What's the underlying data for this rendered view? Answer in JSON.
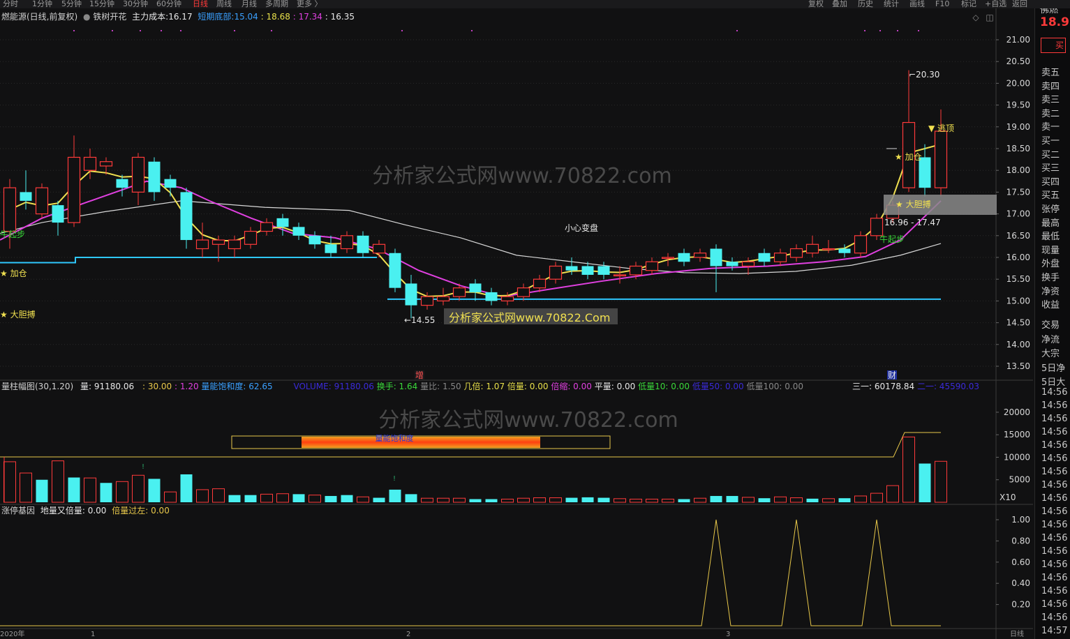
{
  "period_tabs": [
    "分时",
    "1分钟",
    "5分钟",
    "15分钟",
    "30分钟",
    "60分钟",
    "日线",
    "周线",
    "月线",
    "多周期",
    "更多 〉"
  ],
  "active_tab": "日线",
  "right_buttons": [
    "复权",
    "叠加",
    "历史",
    "统计",
    "画线",
    "F10",
    "标记",
    "+自选",
    "返回"
  ],
  "stock_title": "燃能源(日线,前复权)",
  "indicator_name": "铁树开花",
  "cost_label": "主力成本:",
  "cost_value": "16.17",
  "short_bottom_label": "短期底部:",
  "short_bottom_value": "15.04",
  "v2": "18.68",
  "v3": "17.34",
  "v4": "16.35",
  "watermark_top": "分析家公式网www.70822.com",
  "watermark_box": "分析家公式网www.70822.Com",
  "watermark_mid": "分析家公式网www.70822.com",
  "signals": {
    "buy_start": "牛起步",
    "add_pos": "★ 加仓",
    "bold": "★ 大胆搏",
    "add_right": "★ 加仓",
    "escape_top": "▼ 逃顶",
    "bold_right": "★ 大胆搏",
    "buy_start_right": "牛起步",
    "careful": "小心变盘"
  },
  "price_annotations": {
    "high": "20.30",
    "low": "←14.55",
    "band": "16.96 - 17.47"
  },
  "markers": {
    "zeng": "增",
    "cai": "财"
  },
  "price_axis": [
    "21.00",
    "20.50",
    "20.00",
    "19.50",
    "19.00",
    "18.50",
    "18.00",
    "17.50",
    "17.00",
    "16.50",
    "16.00",
    "15.50",
    "15.00",
    "14.50",
    "14.00",
    "13.50"
  ],
  "vol_header": {
    "name": "量柱幅图(30,1.20)",
    "vol_label": "量:",
    "vol_value": "91180.06",
    "p1": ": 30.00",
    "p2": ": 1.20",
    "sat_label": "量能饱和度:",
    "sat_value": "62.65",
    "volume_label": "VOLUME: 91180.06",
    "turnover": "换手: 1.64",
    "ratio": "量比: 1.50",
    "times": "几倍: 1.07",
    "double": "倍量: 0.00",
    "shrink": "倍缩: 0.00",
    "flat": "平量: 0.00",
    "low10": "低量10: 0.00",
    "low50": "低量50: 0.00",
    "low100": "低量100: 0.00",
    "sanyi": "三一: 60178.84",
    "sanyi2": "二一: 45590.03"
  },
  "saturation_bar_label": "量能饱和度",
  "vol_axis": [
    "20000",
    "15000",
    "10000",
    "5000"
  ],
  "vol_unit": "X10",
  "zt_header": {
    "name": "涨停基因",
    "label1": "地量又倍量: 0.00",
    "label2": "倍量过左: 0.00"
  },
  "zt_axis": [
    "1.00",
    "0.80",
    "0.60",
    "0.40",
    "0.20"
  ],
  "side_price": "18.9",
  "side_buy_btn": "买",
  "side_header": "佛燃",
  "side_labels": [
    "卖五",
    "卖四",
    "卖三",
    "卖二",
    "卖一",
    "买一",
    "买二",
    "买三",
    "买四",
    "买五",
    "张停",
    "最高",
    "最低",
    "现量",
    "外盘",
    "换手",
    "净资",
    "收益",
    "交易",
    "净流",
    "大宗",
    "5日净",
    "5日大"
  ],
  "side_times": [
    "14:56",
    "14:56",
    "14:56",
    "14:56",
    "14:56",
    "14:56",
    "14:56",
    "14:56",
    "14:56",
    "14:56",
    "14:56",
    "14:56",
    "14:56",
    "14:56",
    "14:56",
    "14:56",
    "14:56",
    "14:56",
    "14:57"
  ],
  "bottom_axis": [
    "2020年",
    "1",
    "2",
    "3",
    "日线"
  ],
  "chart_data": [
    {
      "type": "candlestick",
      "y_range": [
        13.3,
        21.3
      ],
      "candles": [
        [
          16.6,
          17.6,
          17.8,
          16.2
        ],
        [
          17.5,
          17.3,
          18.0,
          17.1
        ],
        [
          17.0,
          17.6,
          17.7,
          16.9
        ],
        [
          17.2,
          16.8,
          17.3,
          16.5
        ],
        [
          16.8,
          18.3,
          18.8,
          16.7
        ],
        [
          18.0,
          18.3,
          18.5,
          17.8
        ],
        [
          18.1,
          18.2,
          18.3,
          17.9
        ],
        [
          17.8,
          17.6,
          17.9,
          17.4
        ],
        [
          17.5,
          18.3,
          18.4,
          17.2
        ],
        [
          18.2,
          17.5,
          18.3,
          17.3
        ],
        [
          17.8,
          17.6,
          17.9,
          17.4
        ],
        [
          17.5,
          16.4,
          17.6,
          16.2
        ],
        [
          16.2,
          16.4,
          16.8,
          16.0
        ],
        [
          16.3,
          16.4,
          16.5,
          15.9
        ],
        [
          16.2,
          16.4,
          16.5,
          16.0
        ],
        [
          16.3,
          16.6,
          16.7,
          16.2
        ],
        [
          16.6,
          16.8,
          16.9,
          16.5
        ],
        [
          16.9,
          16.7,
          17.0,
          16.5
        ],
        [
          16.7,
          16.5,
          16.8,
          16.4
        ],
        [
          16.5,
          16.3,
          16.6,
          16.2
        ],
        [
          16.3,
          16.1,
          16.5,
          16.0
        ],
        [
          16.2,
          16.5,
          16.6,
          16.1
        ],
        [
          16.5,
          16.1,
          16.6,
          16.0
        ],
        [
          16.1,
          16.3,
          16.4,
          16.0
        ],
        [
          16.1,
          15.3,
          16.2,
          15.2
        ],
        [
          15.4,
          14.9,
          15.6,
          14.6
        ],
        [
          14.9,
          15.1,
          15.2,
          14.8
        ],
        [
          15.0,
          15.1,
          15.3,
          14.9
        ],
        [
          15.1,
          15.3,
          15.4,
          15.0
        ],
        [
          15.4,
          15.2,
          15.5,
          15.0
        ],
        [
          15.2,
          15.0,
          15.3,
          14.9
        ],
        [
          15.0,
          15.1,
          15.2,
          14.9
        ],
        [
          15.1,
          15.3,
          15.4,
          15.0
        ],
        [
          15.3,
          15.5,
          15.6,
          15.2
        ],
        [
          15.5,
          15.8,
          15.9,
          15.4
        ],
        [
          15.8,
          15.7,
          16.0,
          15.6
        ],
        [
          15.8,
          15.6,
          15.9,
          15.5
        ],
        [
          15.8,
          15.6,
          15.9,
          15.5
        ],
        [
          15.6,
          15.6,
          15.8,
          15.4
        ],
        [
          15.6,
          15.8,
          15.9,
          15.5
        ],
        [
          15.7,
          15.9,
          16.0,
          15.6
        ],
        [
          16.0,
          16.0,
          16.1,
          15.8
        ],
        [
          16.1,
          15.9,
          16.2,
          15.8
        ],
        [
          16.0,
          16.1,
          16.2,
          15.9
        ],
        [
          16.2,
          15.8,
          16.3,
          15.2
        ],
        [
          15.9,
          15.8,
          16.0,
          15.7
        ],
        [
          15.8,
          15.9,
          16.0,
          15.6
        ],
        [
          16.1,
          15.9,
          16.2,
          15.8
        ],
        [
          15.9,
          16.1,
          16.2,
          15.8
        ],
        [
          16.0,
          16.2,
          16.3,
          15.9
        ],
        [
          16.1,
          16.3,
          16.5,
          16.0
        ],
        [
          16.2,
          16.2,
          16.4,
          16.1
        ],
        [
          16.2,
          16.1,
          16.3,
          16.0
        ],
        [
          16.1,
          16.5,
          16.6,
          16.0
        ],
        [
          16.5,
          16.9,
          17.0,
          16.4
        ],
        [
          16.9,
          17.2,
          17.3,
          16.8
        ],
        [
          17.6,
          19.1,
          20.3,
          17.5
        ],
        [
          18.3,
          17.6,
          18.6,
          17.4
        ],
        [
          17.6,
          18.9,
          19.4,
          17.4
        ]
      ],
      "ma_white_from": 16.4,
      "ma_yellow_last": 18.6,
      "ma_magenta_last": 17.3,
      "support_cyan": 15.04
    },
    {
      "type": "bar",
      "title": "volume",
      "ylim": [
        0,
        22000
      ],
      "values": [
        9000,
        6500,
        5000,
        9200,
        5500,
        5400,
        4300,
        4600,
        6000,
        5200,
        2300,
        6200,
        2800,
        3000,
        1600,
        1600,
        1800,
        1900,
        1800,
        1600,
        1400,
        1600,
        1200,
        1000,
        2800,
        1800,
        900,
        900,
        900,
        700,
        700,
        700,
        900,
        1000,
        1000,
        1000,
        1100,
        1000,
        800,
        700,
        700,
        700,
        700,
        900,
        1400,
        1400,
        1100,
        900,
        1200,
        1000,
        800,
        800,
        900,
        1400,
        2000,
        3700,
        14500,
        8600,
        9100
      ],
      "up": [
        true,
        true,
        false,
        true,
        false,
        true,
        false,
        true,
        true,
        false,
        true,
        false,
        true,
        true,
        false,
        false,
        true,
        true,
        false,
        true,
        false,
        false,
        true,
        false,
        false,
        false,
        true,
        true,
        true,
        false,
        false,
        true,
        true,
        true,
        true,
        false,
        false,
        false,
        true,
        true,
        true,
        true,
        false,
        true,
        false,
        false,
        true,
        false,
        true,
        true,
        false,
        true,
        false,
        true,
        true,
        true,
        true,
        false,
        true
      ]
    },
    {
      "type": "line",
      "title": "涨停基因",
      "ylim": [
        0,
        1.1
      ],
      "spikes_at_index": [
        44,
        49,
        54
      ]
    }
  ]
}
